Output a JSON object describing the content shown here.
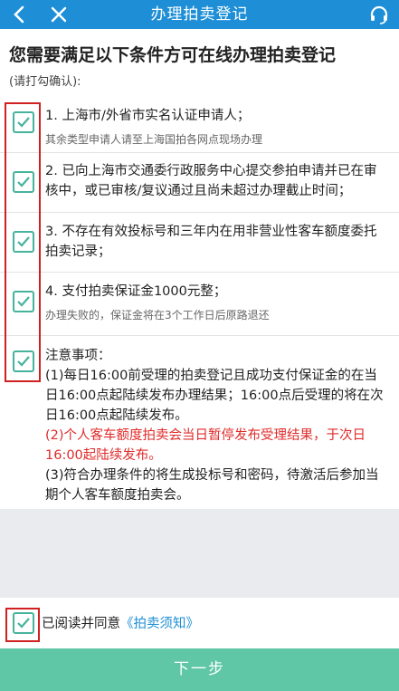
{
  "header": {
    "title": "办理拍卖登记"
  },
  "intro": {
    "heading": "您需要满足以下条件方可在线办理拍卖登记",
    "hint": "(请打勾确认):"
  },
  "conditions": [
    {
      "checked": true,
      "text": "1. 上海市/外省市实名认证申请人；",
      "sub": "其余类型申请人请至上海国拍各网点现场办理"
    },
    {
      "checked": true,
      "text": "2. 已向上海市交通委行政服务中心提交参拍申请并已在审核中，或已审核/复议通过且尚未超过办理截止时间；"
    },
    {
      "checked": true,
      "text": "3. 不存在有效投标号和三年内在用非营业性客车额度委托拍卖记录；"
    },
    {
      "checked": true,
      "text": "4. 支付拍卖保证金1000元整；",
      "sub": "办理失败的，保证金将在3个工作日后原路退还"
    },
    {
      "checked": true,
      "title": "注意事项：",
      "notes": [
        "(1)每日16:00前受理的拍卖登记且成功支付保证金的在当日16:00点起陆续发布办理结果；16:00点后受理的将在次日16:00点起陆续发布。",
        "(2)个人客车额度拍卖会当日暂停发布受理结果，于次日16:00起陆续发布。",
        "(3)符合办理条件的将生成投标号和密码，待激活后参加当期个人客车额度拍卖会。"
      ]
    }
  ],
  "agreement": {
    "checked": true,
    "prefix": "已阅读并同意",
    "link": "《拍卖须知》"
  },
  "next_button": "下一步",
  "colors": {
    "header": "#1e8fd6",
    "checkbox": "#46b39d",
    "button": "#5fc6a6",
    "warning": "#e02a2a",
    "highlight": "#d02020"
  }
}
